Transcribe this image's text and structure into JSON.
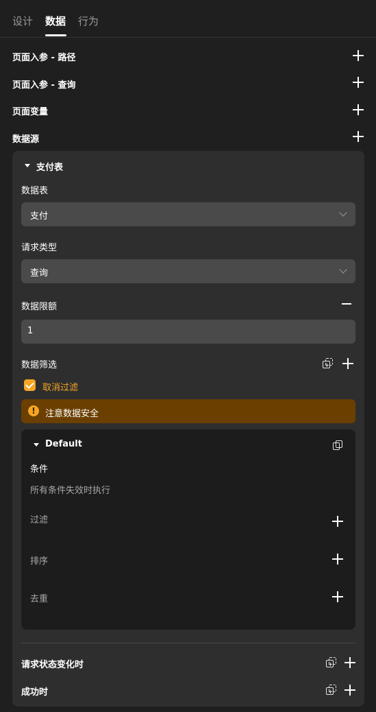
{
  "tabs": [
    {
      "label": "设计",
      "active": false
    },
    {
      "label": "数据",
      "active": true
    },
    {
      "label": "行为",
      "active": false
    }
  ],
  "sections": {
    "path_params": "页面入参 - 路径",
    "query_params": "页面入参 - 查询",
    "page_vars": "页面变量",
    "datasource": "数据源"
  },
  "datasource": {
    "name": "支付表",
    "table_label": "数据表",
    "table_value": "支付",
    "request_type_label": "请求类型",
    "request_type_value": "查询",
    "limit_label": "数据限额",
    "limit_value": "1",
    "filter_label": "数据筛选",
    "cancel_filter_label": "取消过滤",
    "cancel_filter_checked": true,
    "warning_text": "注意数据安全",
    "default_block": {
      "title": "Default",
      "condition_label": "条件",
      "condition_hint": "所有条件失效时执行",
      "filter": "过滤",
      "sort": "排序",
      "dedupe": "去重"
    },
    "on_state_change": "请求状态变化时",
    "on_success": "成功时"
  },
  "colors": {
    "background": "#1f1f1f",
    "panel": "#2e2e2e",
    "input": "#4a4a4a",
    "accent": "#f5a623",
    "warning_bg": "#6b3f00"
  }
}
